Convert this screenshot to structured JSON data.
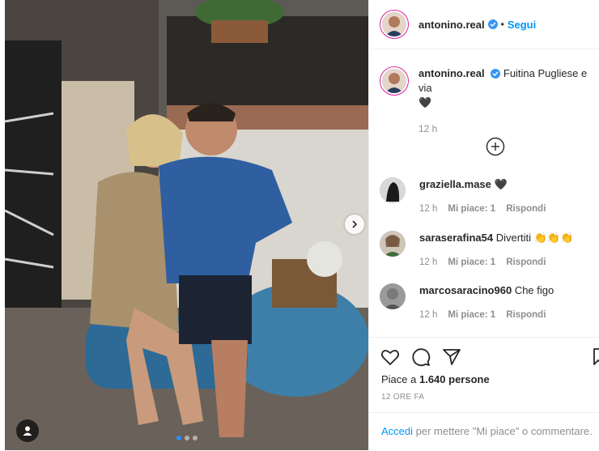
{
  "post": {
    "username": "antonino.real",
    "verified": true,
    "follow_label": "Segui",
    "dot": "•",
    "photo_desc_icon": "user-tag-icon",
    "carousel": {
      "count": 3,
      "active": 0
    }
  },
  "caption": {
    "username": "antonino.real",
    "text": "Fuitina Pugliese e via",
    "emoji": "🖤",
    "time": "12 h"
  },
  "comments": [
    {
      "username": "graziella.mase",
      "text": "🖤",
      "time": "12 h",
      "likes": "Mi piace: 1",
      "reply": "Rispondi"
    },
    {
      "username": "saraserafina54",
      "text": "Divertiti 👏👏👏",
      "time": "12 h",
      "likes": "Mi piace: 1",
      "reply": "Rispondi"
    },
    {
      "username": "marcosaracino960",
      "text": "Che figo",
      "time": "12 h",
      "likes": "Mi piace: 1",
      "reply": "Rispondi"
    }
  ],
  "actions": {
    "likes_prefix": "Piace a ",
    "likes_count": "1.640 persone",
    "ago": "12 ORE FA"
  },
  "login": {
    "link": "Accedi",
    "text": " per mettere \"Mi piace\" o commentare."
  },
  "colors": {
    "link": "#0095f6",
    "muted": "#8e8e8e",
    "verified": "#3897f0",
    "story_ring": "#d6249f"
  }
}
